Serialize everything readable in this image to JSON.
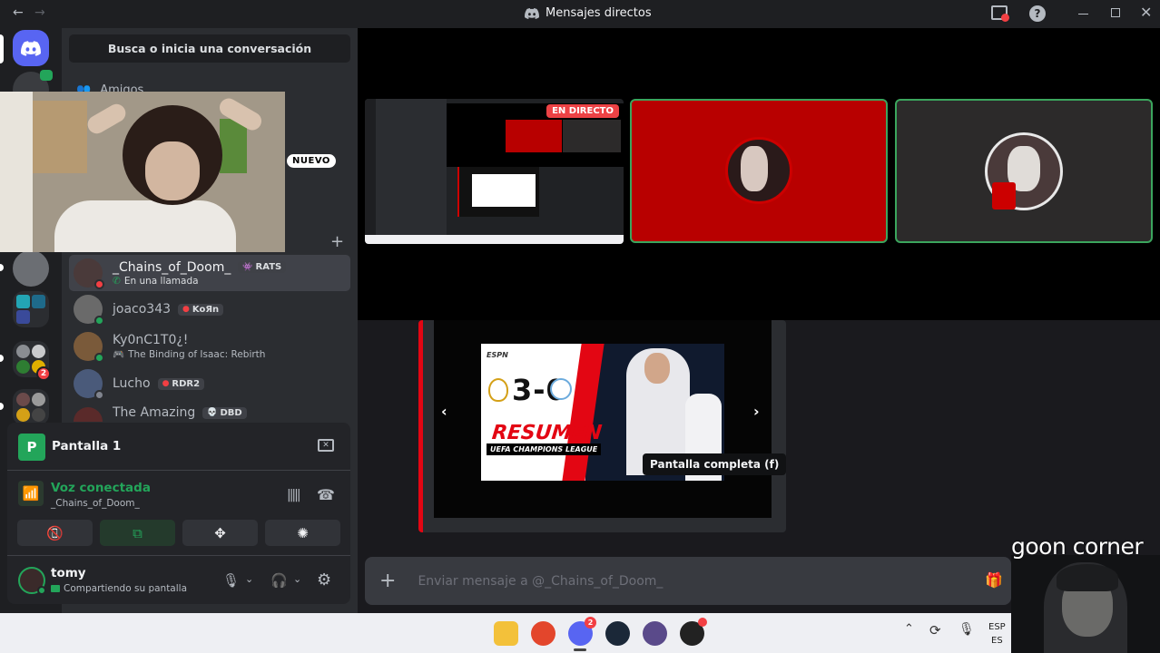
{
  "window": {
    "title": "Mensajes directos",
    "back_icon": "←",
    "forward_icon": "→"
  },
  "sidebar": {
    "search_placeholder": "Busca o inicia una conversación",
    "friends_label": "Amigos",
    "new_badge": "NUEVO",
    "dms": [
      {
        "name": "_Chains_of_Doom_",
        "tag": "RATS",
        "status_text": "En una llamada",
        "status": "dnd",
        "active": true,
        "avatar_color": "#4a3a3a"
      },
      {
        "name": "joaco343",
        "tag": "KoЯn",
        "status_text": "",
        "status": "online",
        "active": false,
        "avatar_color": "#6a6a6a"
      },
      {
        "name": "Ky0nC1T0¿!",
        "tag": "",
        "status_text": "The Binding of Isaac: Rebirth",
        "status": "online",
        "active": false,
        "avatar_color": "#7a5a3a"
      },
      {
        "name": "Lucho",
        "tag": "RDR2",
        "status_text": "",
        "status": "idle",
        "active": false,
        "avatar_color": "#4a5a7a"
      },
      {
        "name": "The Amazing",
        "tag": "DBD",
        "status_text": "",
        "status": "dnd",
        "active": false,
        "avatar_color": "#5a2a2a"
      }
    ]
  },
  "voice": {
    "stream_title": "Pantalla 1",
    "connected_label": "Voz conectada",
    "channel": "_Chains_of_Doom_"
  },
  "user": {
    "name": "tomy",
    "status": "Compartiendo su pantalla"
  },
  "stage": {
    "live_badge": "EN DIRECTO"
  },
  "embed": {
    "score": "3-0",
    "brand": "ESPN",
    "title": "RESUMEN",
    "subtitle": "UEFA CHAMPIONS LEAGUE",
    "tooltip": "Pantalla completa (f)"
  },
  "chat": {
    "placeholder": "Enviar mensaje a @_Chains_of_Doom_"
  },
  "taskbar": {
    "lang_top": "ESP",
    "lang_bottom": "ES",
    "discord_badge": "2"
  },
  "overlay": {
    "caption": "goon corner"
  },
  "colors": {
    "accent": "#5865f2",
    "online": "#23a55a",
    "dnd": "#f23f43",
    "live": "#ed4245",
    "speaking": "#3ba55d"
  }
}
